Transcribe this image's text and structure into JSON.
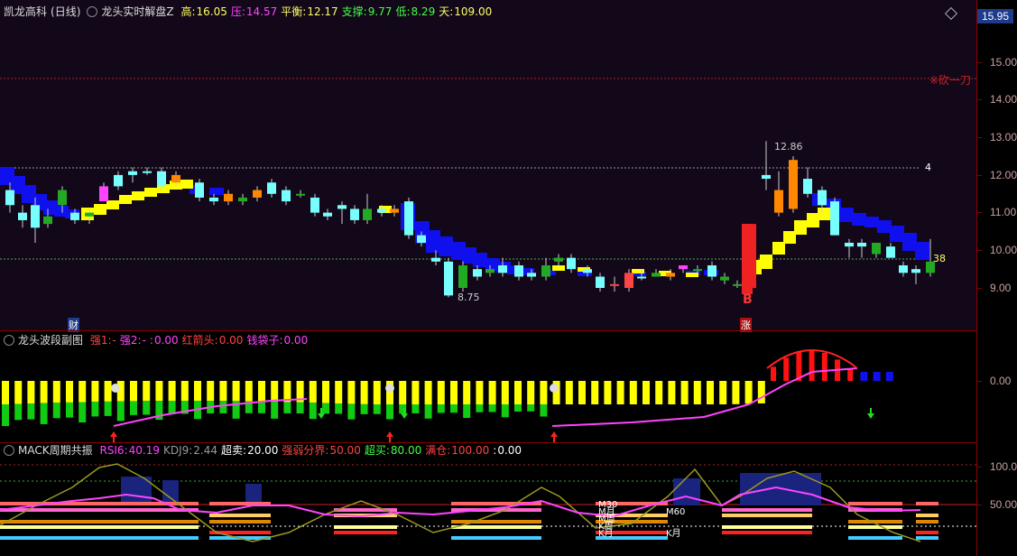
{
  "main": {
    "stock_name": "凯龙高科",
    "period": "(日线)",
    "indicator": "龙头实时解盘Z",
    "stats": [
      {
        "label": "高:",
        "value": "16.05",
        "color": "#ffff66"
      },
      {
        "label": "压:",
        "value": "14.57",
        "color": "#ff44ff"
      },
      {
        "label": "平衡:",
        "value": "12.17",
        "color": "#ffff66"
      },
      {
        "label": "支撑:",
        "value": "9.77",
        "color": "#44ff44"
      },
      {
        "label": "低:",
        "value": "8.29",
        "color": "#44ff44"
      },
      {
        "label": "天:",
        "value": "109.00",
        "color": "#ffff66"
      }
    ],
    "axis": [
      "15.00",
      "14.00",
      "13.00",
      "12.00",
      "11.00",
      "10.00",
      "9.00"
    ],
    "current_price": "15.95",
    "annotations": {
      "cut_label": "※砍一刀",
      "high_mark": "12.86",
      "low_mark": "8.75",
      "marker_4": "4",
      "marker_38": "38",
      "buy_mark": "B",
      "cai_label": "财",
      "zhang_label": "涨"
    }
  },
  "sub1": {
    "title": "龙头波段副图",
    "items": [
      {
        "label": "强1:",
        "value": "-",
        "color": "#ff4444"
      },
      {
        "label": "强2:",
        "value": "-",
        "color": "#ff44ff"
      },
      {
        "label": ":",
        "value": "0.00",
        "color": "#ff44ff"
      },
      {
        "label": "红箭头:",
        "value": "0.00",
        "color": "#ff4444"
      },
      {
        "label": "钱袋子:",
        "value": "0.00",
        "color": "#ff44ff"
      }
    ],
    "axis": [
      "0.00"
    ]
  },
  "sub2": {
    "title": "MACK周期共振",
    "items": [
      {
        "label": "RSI6:",
        "value": "40.19",
        "color": "#ff44ff"
      },
      {
        "label": "KDJ9:",
        "value": "2.44",
        "color": "#999999"
      },
      {
        "label": "超卖:",
        "value": "20.00",
        "color": "#ffffff"
      },
      {
        "label": "强弱分界:",
        "value": "50.00",
        "color": "#ff4444"
      },
      {
        "label": "超买:",
        "value": "80.00",
        "color": "#44ff44"
      },
      {
        "label": "满仓:",
        "value": "100.00",
        "color": "#ff4444"
      },
      {
        "label": ":",
        "value": "0.00",
        "color": "#ffffff"
      }
    ],
    "axis": [
      "100.00",
      "50.00"
    ],
    "labels": [
      "M30",
      "M月",
      "M周",
      "K周",
      "K月",
      "M60",
      "K月"
    ]
  }
}
